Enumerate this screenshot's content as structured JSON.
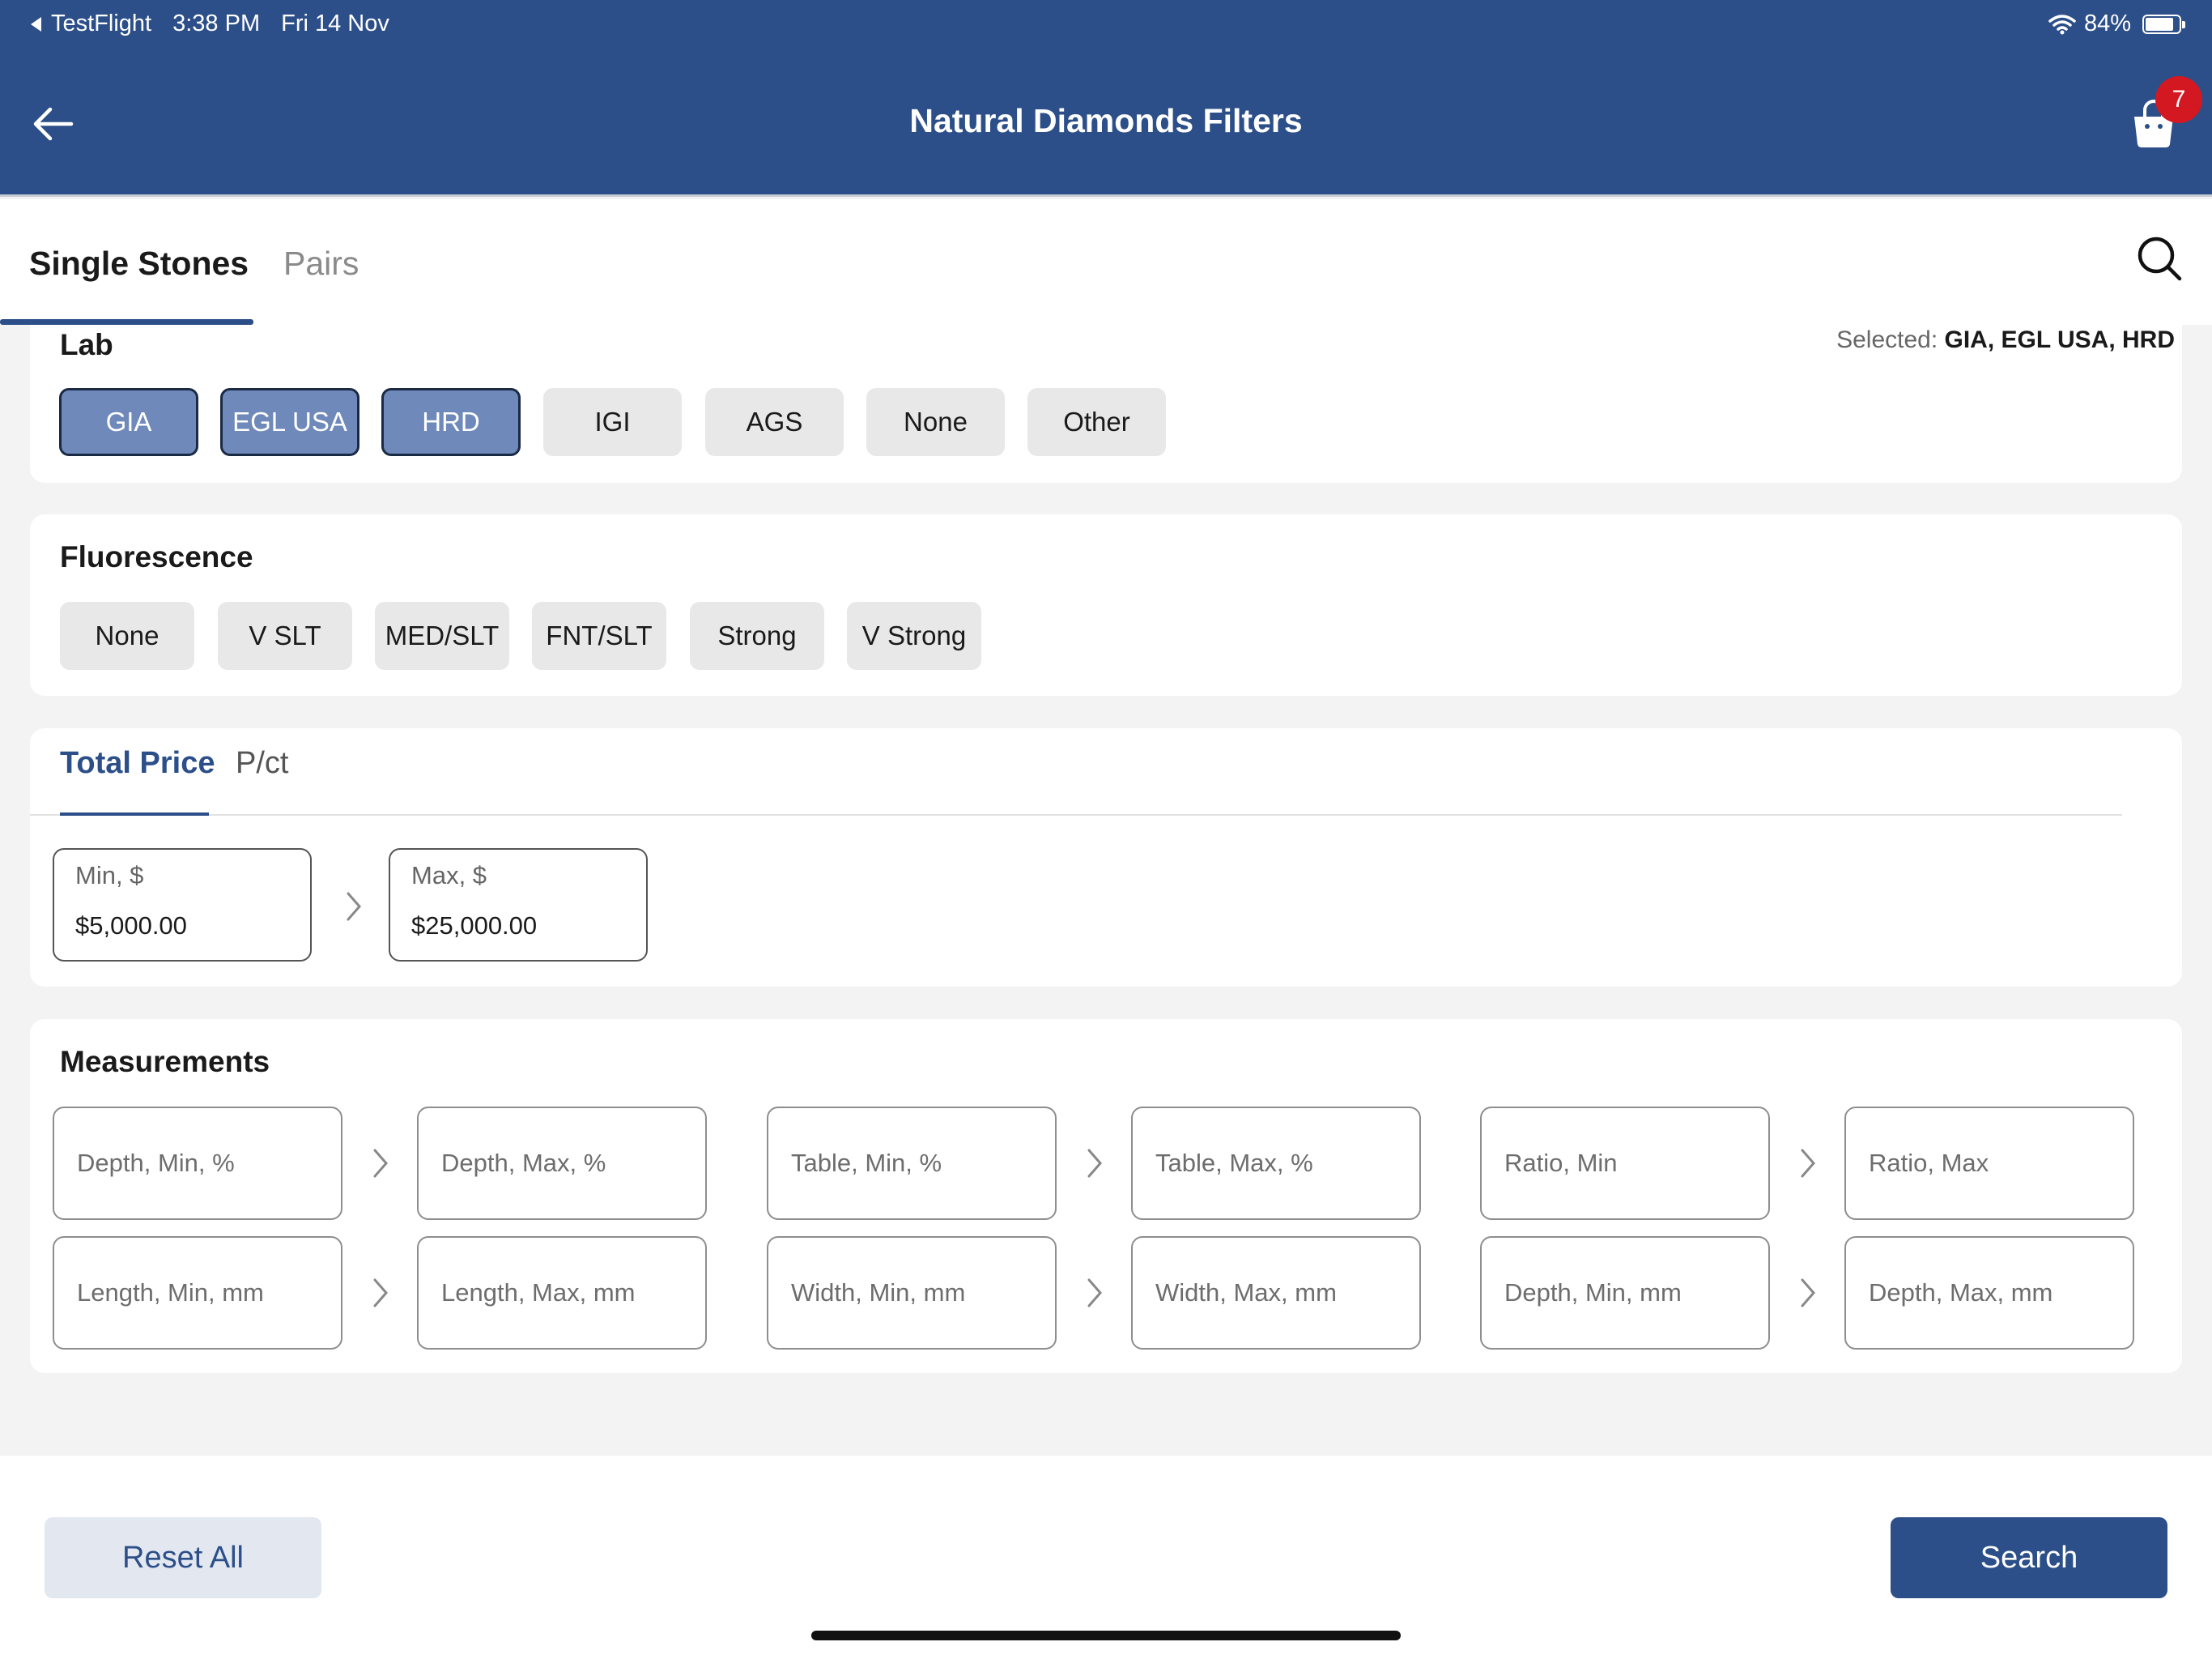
{
  "status_bar": {
    "back_app": "TestFlight",
    "time": "3:38 PM",
    "date": "Fri 14 Nov",
    "battery": "84%",
    "battery_level": 0.84
  },
  "header": {
    "title": "Natural Diamonds Filters",
    "cart_count": "7",
    "back_icon": "arrow-left-icon",
    "cart_icon": "cart-icon"
  },
  "tabs": {
    "items": [
      "Single Stones",
      "Pairs"
    ],
    "active": "Single Stones"
  },
  "lab": {
    "title": "Lab",
    "selected_label": "Selected:",
    "selected_value": "GIA, EGL USA, HRD",
    "options": [
      "GIA",
      "EGL USA",
      "HRD",
      "IGI",
      "AGS",
      "None",
      "Other"
    ],
    "selected": [
      "GIA",
      "EGL USA",
      "HRD"
    ]
  },
  "fluorescence": {
    "title": "Fluorescence",
    "options": [
      "None",
      "V SLT",
      "MED/SLT",
      "FNT/SLT",
      "Strong",
      "V Strong"
    ]
  },
  "price": {
    "tabs": [
      "Total Price",
      "P/ct"
    ],
    "active_tab": "Total Price",
    "min_label": "Min, $",
    "min_value": "$5,000.00",
    "max_label": "Max, $",
    "max_value": "$25,000.00"
  },
  "measurements": {
    "title": "Measurements",
    "row1": [
      "Depth, Min, %",
      "Depth, Max, %",
      "Table, Min, %",
      "Table, Max, %",
      "Ratio, Min",
      "Ratio, Max"
    ],
    "row2": [
      "Length, Min, mm",
      "Length, Max, mm",
      "Width, Min, mm",
      "Width, Max, mm",
      "Depth, Min, mm",
      "Depth, Max, mm"
    ]
  },
  "actions": {
    "reset": "Reset All",
    "search": "Search"
  },
  "colors": {
    "primary": "#2c4f89",
    "chip_selected": "#6f89ba",
    "badge": "#d31821",
    "chip": "#e8e8e8"
  }
}
